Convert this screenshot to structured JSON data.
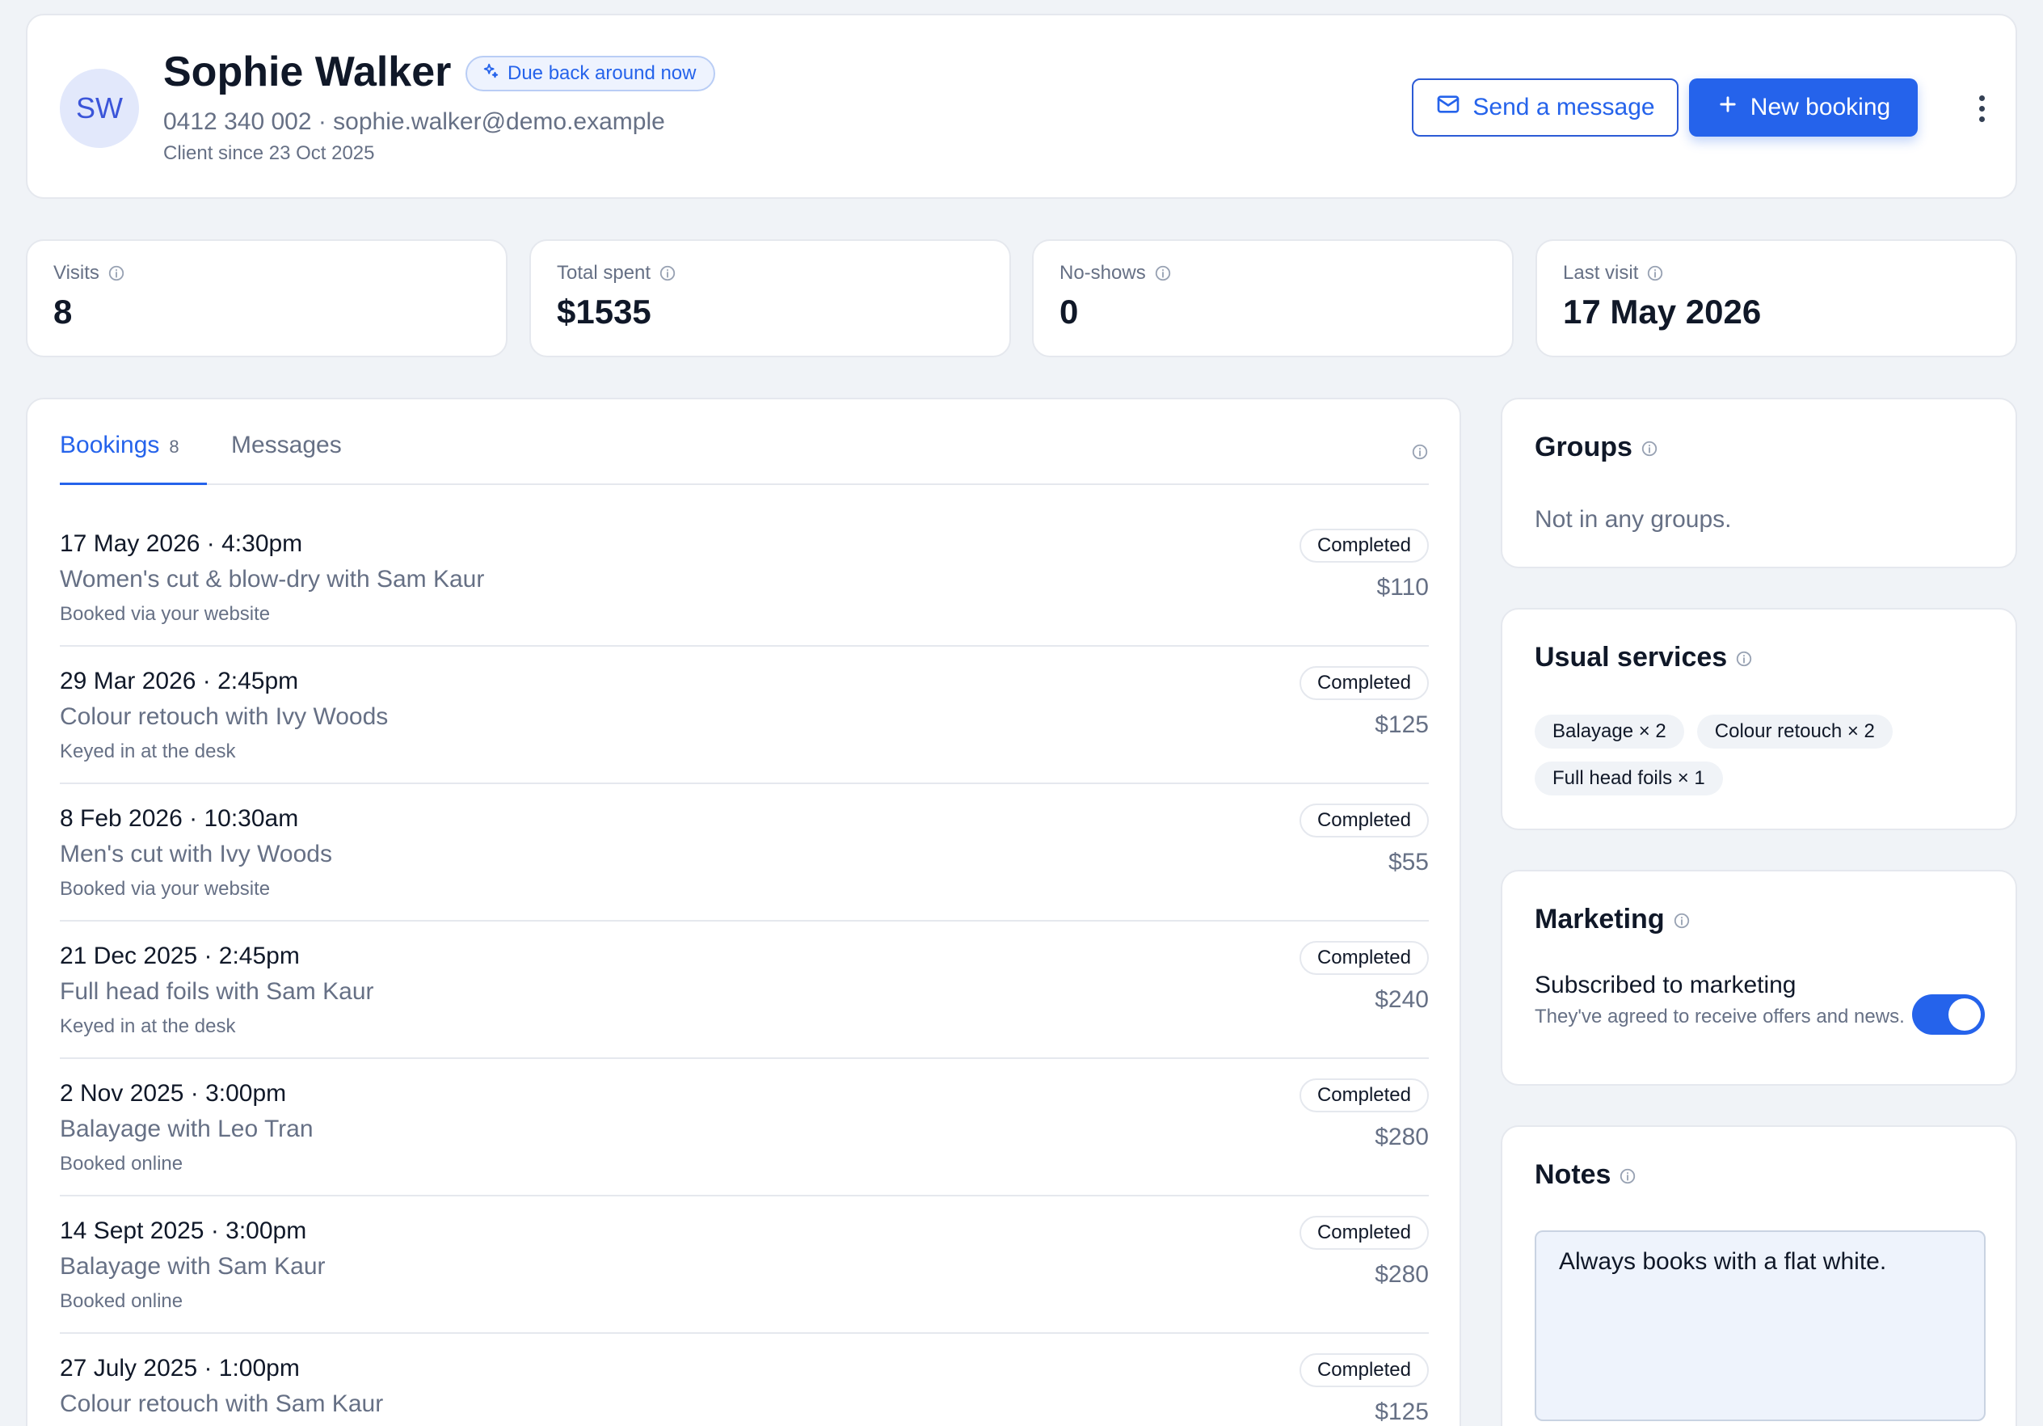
{
  "client": {
    "initials": "SW",
    "name": "Sophie Walker",
    "badge": "Due back around now",
    "contact": "0412 340 002 · sophie.walker@demo.example",
    "since": "Client since 23 Oct 2025"
  },
  "actions": {
    "message_label": "Send a message",
    "new_booking_label": "New booking"
  },
  "stats": [
    {
      "label": "Visits",
      "value": "8"
    },
    {
      "label": "Total spent",
      "value": "$1535"
    },
    {
      "label": "No-shows",
      "value": "0"
    },
    {
      "label": "Last visit",
      "value": "17 May 2026"
    }
  ],
  "tabs": {
    "bookings_label": "Bookings",
    "bookings_count": "8",
    "messages_label": "Messages"
  },
  "bookings": [
    {
      "when": "17 May 2026 · 4:30pm",
      "service": "Women's cut & blow-dry with Sam Kaur",
      "source": "Booked via your website",
      "status": "Completed",
      "price": "$110"
    },
    {
      "when": "29 Mar 2026 · 2:45pm",
      "service": "Colour retouch with Ivy Woods",
      "source": "Keyed in at the desk",
      "status": "Completed",
      "price": "$125"
    },
    {
      "when": "8 Feb 2026 · 10:30am",
      "service": "Men's cut with Ivy Woods",
      "source": "Booked via your website",
      "status": "Completed",
      "price": "$55"
    },
    {
      "when": "21 Dec 2025 · 2:45pm",
      "service": "Full head foils with Sam Kaur",
      "source": "Keyed in at the desk",
      "status": "Completed",
      "price": "$240"
    },
    {
      "when": "2 Nov 2025 · 3:00pm",
      "service": "Balayage with Leo Tran",
      "source": "Booked online",
      "status": "Completed",
      "price": "$280"
    },
    {
      "when": "14 Sept 2025 · 3:00pm",
      "service": "Balayage with Sam Kaur",
      "source": "Booked online",
      "status": "Completed",
      "price": "$280"
    },
    {
      "when": "27 July 2025 · 1:00pm",
      "service": "Colour retouch with Sam Kaur",
      "source": "",
      "status": "Completed",
      "price": "$125"
    }
  ],
  "groups": {
    "title": "Groups",
    "empty_text": "Not in any groups."
  },
  "services": {
    "title": "Usual services",
    "chips": [
      "Balayage × 2",
      "Colour retouch × 2",
      "Full head foils × 1"
    ]
  },
  "marketing": {
    "title": "Marketing",
    "subscribed_label": "Subscribed to marketing",
    "description": "They've agreed to receive offers and news.",
    "enabled": true
  },
  "notes": {
    "title": "Notes",
    "text": "Always books with a flat white."
  },
  "colors": {
    "accent": "#2563eb",
    "page_bg": "#f0f3f7",
    "muted_text": "#667085"
  }
}
